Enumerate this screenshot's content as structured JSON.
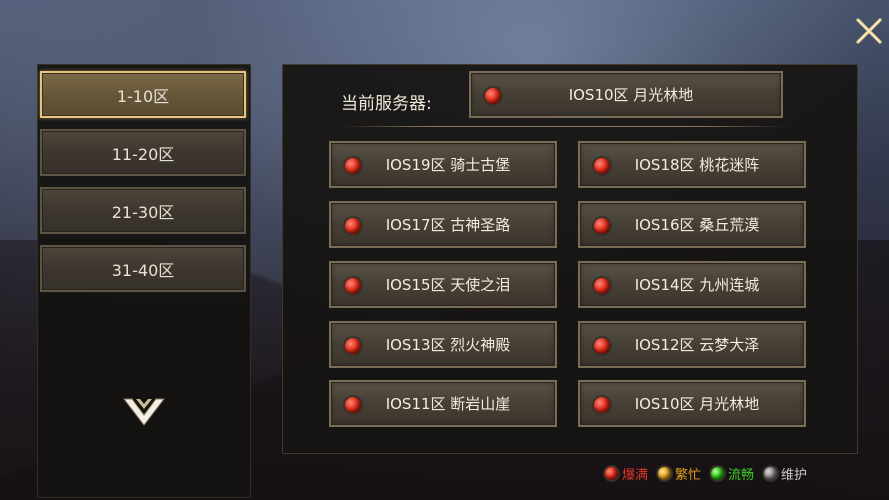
{
  "tabs": [
    {
      "label": "1-10区",
      "active": true
    },
    {
      "label": "11-20区",
      "active": false
    },
    {
      "label": "21-30区",
      "active": false
    },
    {
      "label": "31-40区",
      "active": false
    }
  ],
  "current": {
    "label": "当前服务器:",
    "server": "IOS10区 月光林地",
    "status": "red"
  },
  "servers": [
    {
      "name": "IOS19区 骑士古堡",
      "status": "red"
    },
    {
      "name": "IOS18区 桃花迷阵",
      "status": "red"
    },
    {
      "name": "IOS17区 古神圣路",
      "status": "red"
    },
    {
      "name": "IOS16区 桑丘荒漠",
      "status": "red"
    },
    {
      "name": "IOS15区 天使之泪",
      "status": "red"
    },
    {
      "name": "IOS14区 九州连城",
      "status": "red"
    },
    {
      "name": "IOS13区 烈火神殿",
      "status": "red"
    },
    {
      "name": "IOS12区 云梦大泽",
      "status": "red"
    },
    {
      "name": "IOS11区 断岩山崖",
      "status": "red"
    },
    {
      "name": "IOS10区 月光林地",
      "status": "red"
    }
  ],
  "legend": [
    {
      "label": "爆满",
      "color": "#e0372a",
      "icon": "red-dot"
    },
    {
      "label": "繁忙",
      "color": "#e0a21a",
      "icon": "yellow-dot"
    },
    {
      "label": "流畅",
      "color": "#3ed12a",
      "icon": "green-dot"
    },
    {
      "label": "维护",
      "color": "#c9c9c9",
      "icon": "gray-dot"
    }
  ],
  "colors": {
    "accent_gold": "#e6c57a",
    "panel_bg": "#161412",
    "button_text": "#f2ece0"
  }
}
